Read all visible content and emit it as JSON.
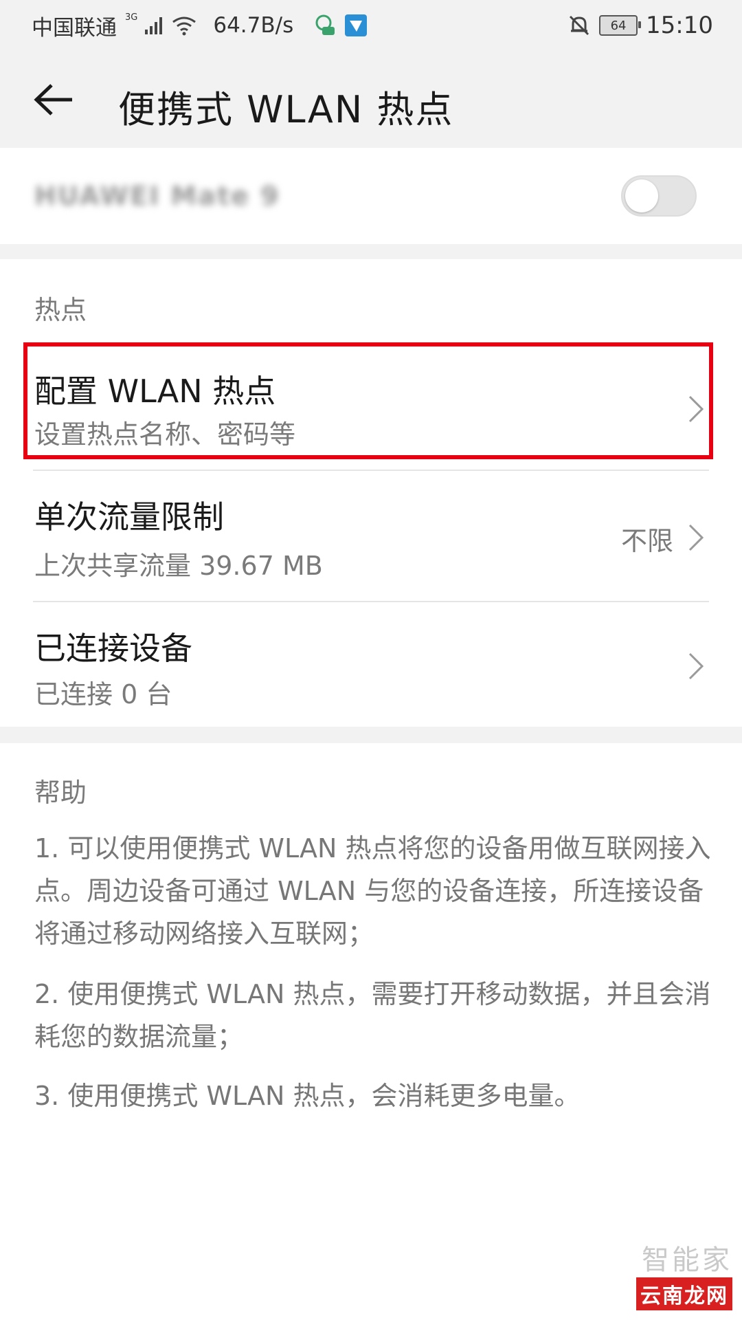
{
  "status_bar": {
    "carrier": "中国联通",
    "network": "3G",
    "speed": "64.7B/s",
    "battery": "64",
    "time": "15:10"
  },
  "header": {
    "title": "便携式 WLAN 热点"
  },
  "hotspot_toggle": {
    "device_name": "HUAWEI Mate 9",
    "enabled": false
  },
  "hotspot_section": {
    "header": "热点",
    "items": [
      {
        "title": "配置 WLAN 热点",
        "subtitle": "设置热点名称、密码等",
        "value": ""
      },
      {
        "title": "单次流量限制",
        "subtitle": "上次共享流量 39.67 MB",
        "value": "不限"
      },
      {
        "title": "已连接设备",
        "subtitle": "已连接 0 台",
        "value": ""
      }
    ]
  },
  "help": {
    "header": "帮助",
    "items": [
      "1. 可以使用便携式 WLAN 热点将您的设备用做互联网接入点。周边设备可通过 WLAN 与您的设备连接，所连接设备将通过移动网络接入互联网；",
      "2. 使用便携式 WLAN 热点，需要打开移动数据，并且会消耗您的数据流量；",
      "3. 使用便携式 WLAN 热点，会消耗更多电量。"
    ]
  },
  "watermark": {
    "line1": "智能家",
    "line2": "云南龙网"
  },
  "colors": {
    "highlight": "#e60012",
    "background_gray": "#f2f2f2"
  }
}
